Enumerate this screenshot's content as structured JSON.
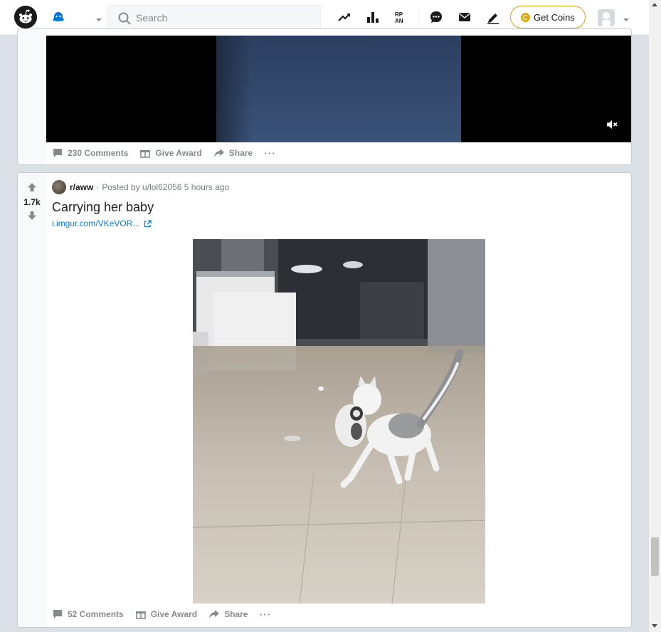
{
  "header": {
    "search_placeholder": "Search",
    "get_coins_label": "Get Coins",
    "icons": [
      "reddit-logo",
      "home-icon",
      "chevron-down-icon",
      "search-icon",
      "trending-icon",
      "leaderboard-icon",
      "rpan-icon",
      "chat-icon",
      "mail-icon",
      "create-post-icon",
      "coin-icon",
      "avatar",
      "chevron-down-icon"
    ],
    "accent": "#0079d3",
    "coins_color": "#dbab17"
  },
  "posts": [
    {
      "comments": "230 Comments",
      "give_award": "Give Award",
      "share": "Share",
      "more": "···"
    },
    {
      "votes": "1.7k",
      "subreddit": "r/aww",
      "separator": "·",
      "posted_by": "Posted by u/lol62056 5 hours ago",
      "title": "Carrying her baby",
      "link": "i.imgur.com/VKeVOR...",
      "comments": "52 Comments",
      "give_award": "Give Award",
      "share": "Share",
      "more": "···"
    }
  ]
}
